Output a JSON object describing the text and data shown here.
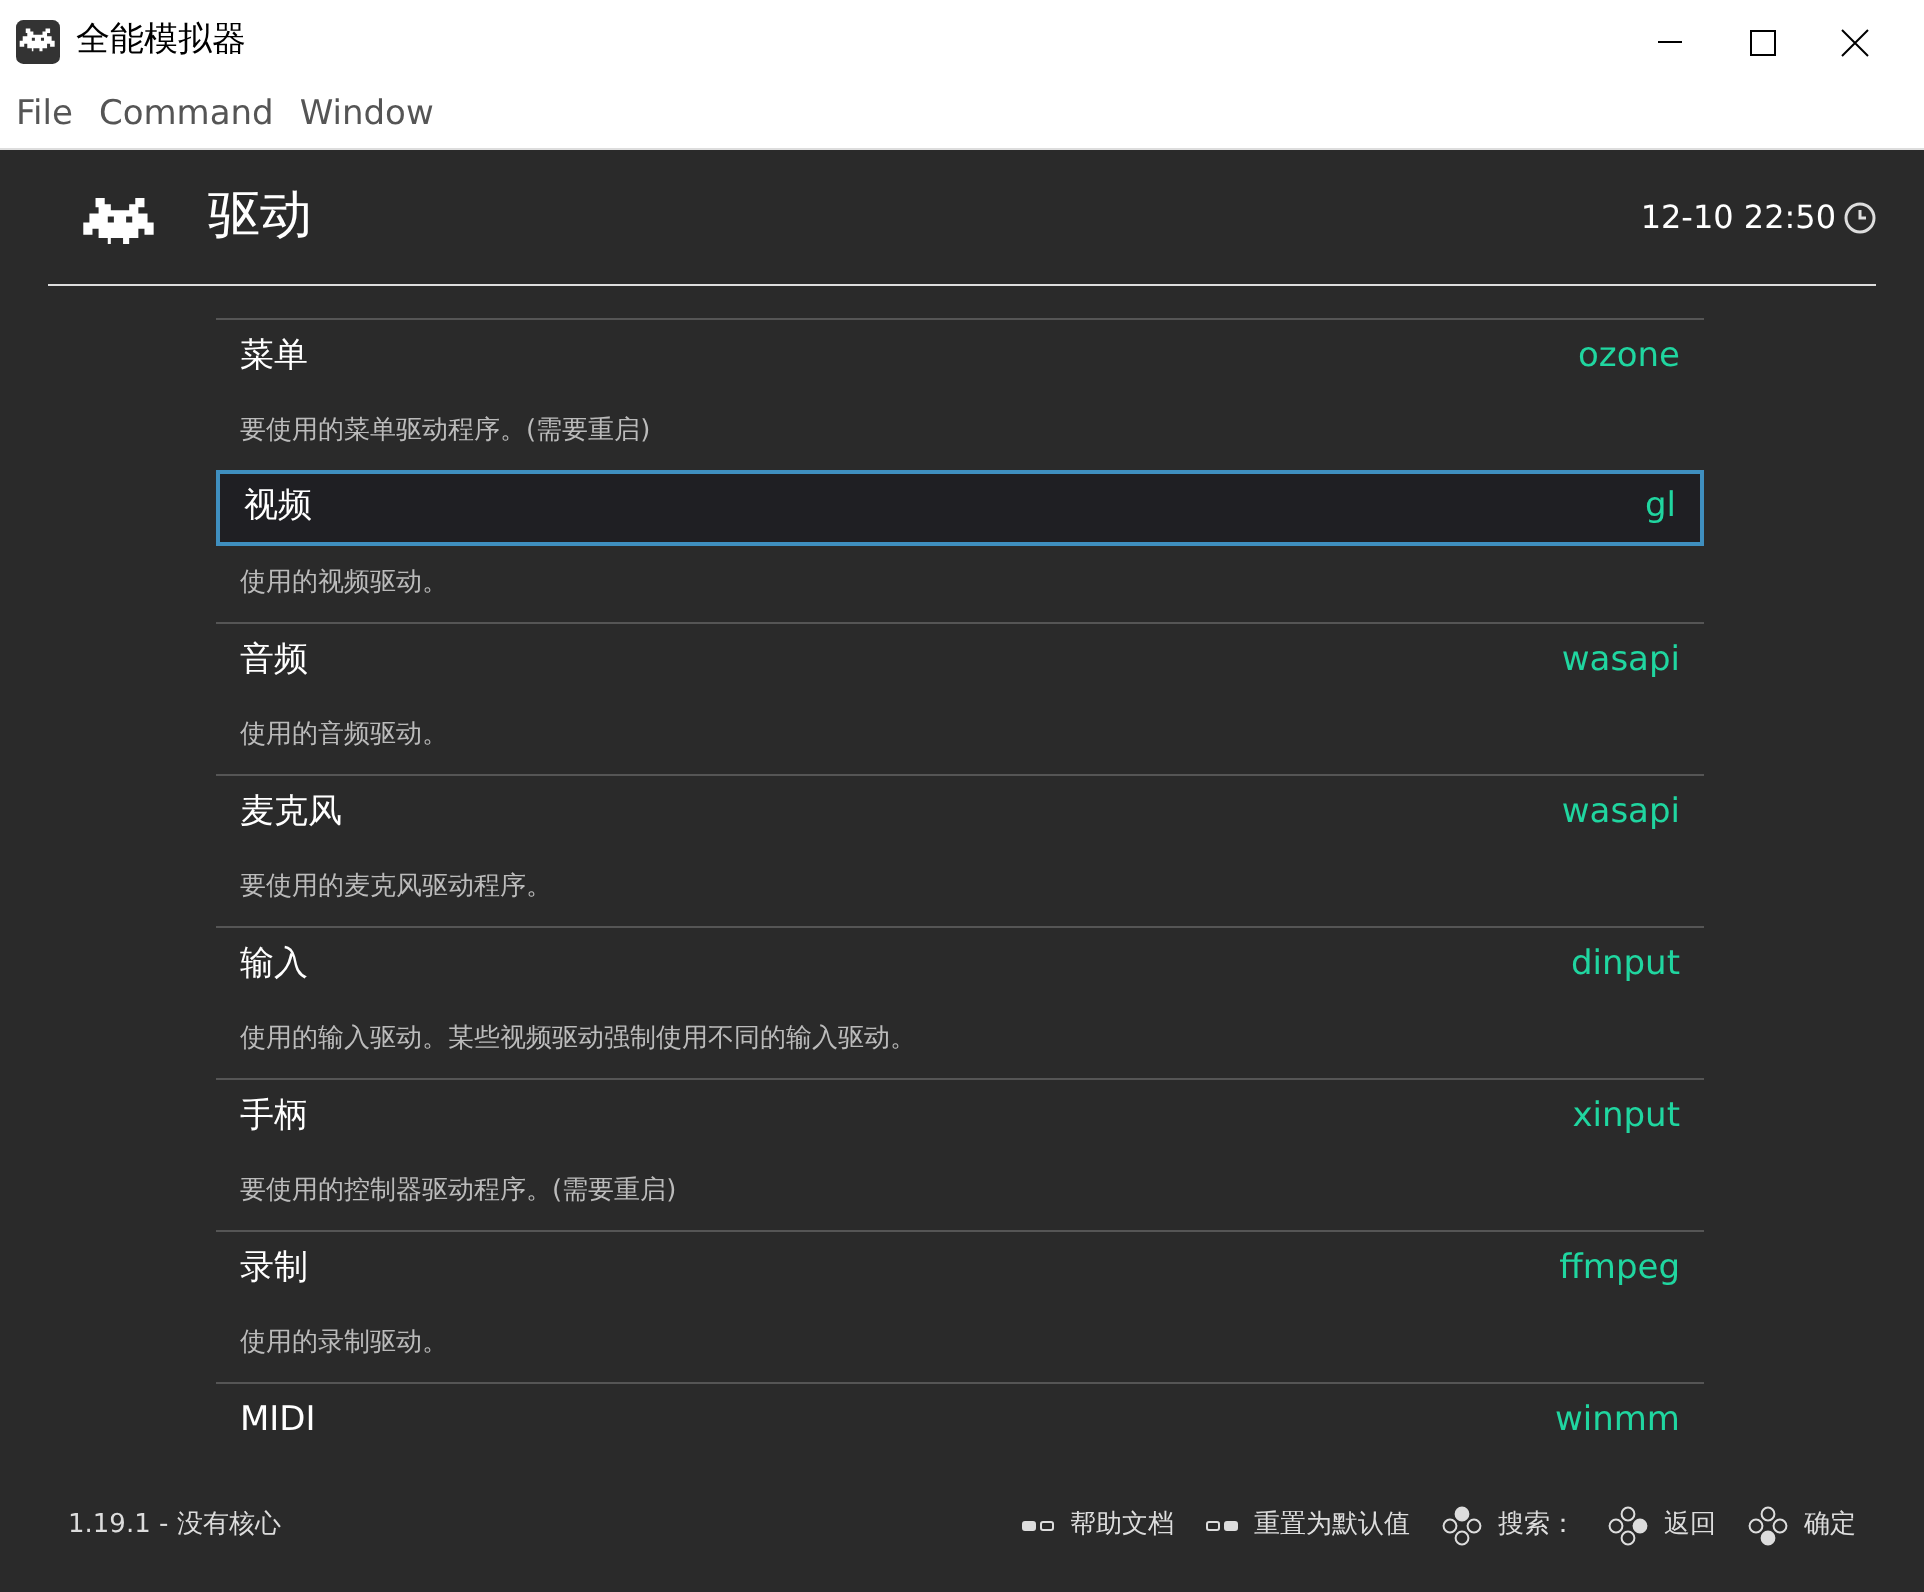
{
  "window": {
    "title": "全能模拟器"
  },
  "menu": [
    "File",
    "Command",
    "Window"
  ],
  "header": {
    "title": "驱动",
    "clock": "12-10 22:50"
  },
  "settings": [
    {
      "label": "菜单",
      "value": "ozone",
      "description": "要使用的菜单驱动程序。(需要重启)",
      "selected": false
    },
    {
      "label": "视频",
      "value": "gl",
      "description": "使用的视频驱动。",
      "selected": true
    },
    {
      "label": "音频",
      "value": "wasapi",
      "description": "使用的音频驱动。",
      "selected": false
    },
    {
      "label": "麦克风",
      "value": "wasapi",
      "description": "要使用的麦克风驱动程序。",
      "selected": false
    },
    {
      "label": "输入",
      "value": "dinput",
      "description": "使用的输入驱动。某些视频驱动强制使用不同的输入驱动。",
      "selected": false
    },
    {
      "label": "手柄",
      "value": "xinput",
      "description": "要使用的控制器驱动程序。(需要重启)",
      "selected": false
    },
    {
      "label": "录制",
      "value": "ffmpeg",
      "description": "使用的录制驱动。",
      "selected": false
    },
    {
      "label": "MIDI",
      "value": "winmm",
      "selected": false
    }
  ],
  "footer": {
    "version": "1.19.1 - 没有核心",
    "hints": [
      {
        "kind": "select",
        "label": "帮助文档"
      },
      {
        "kind": "start",
        "label": "重置为默认值"
      },
      {
        "kind": "north",
        "label": "搜索："
      },
      {
        "kind": "east",
        "label": "返回"
      },
      {
        "kind": "south",
        "label": "确定"
      }
    ]
  }
}
